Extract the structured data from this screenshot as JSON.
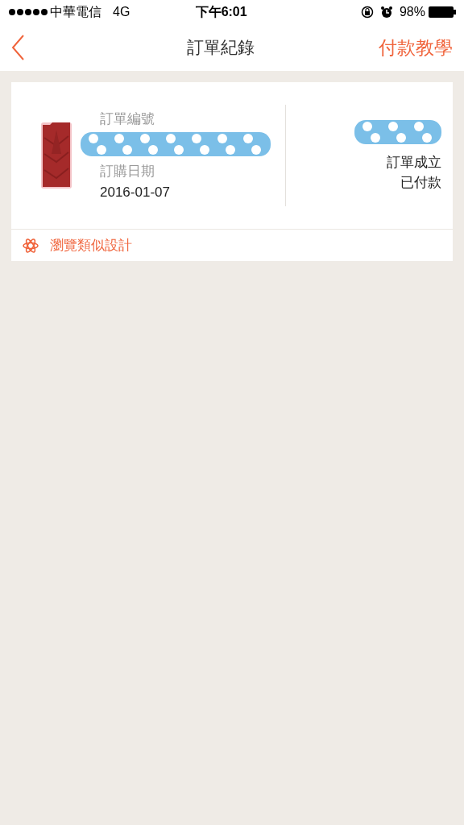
{
  "status_bar": {
    "carrier": "中華電信",
    "network": "4G",
    "time": "下午6:01",
    "battery": "98%"
  },
  "nav": {
    "title": "訂單紀錄",
    "action": "付款教學"
  },
  "orders": [
    {
      "number_label": "訂單編號",
      "date_label": "訂購日期",
      "date": "2016-01-07",
      "status": "訂單成立",
      "payment": "已付款",
      "footer_link": "瀏覽類似設計"
    }
  ]
}
